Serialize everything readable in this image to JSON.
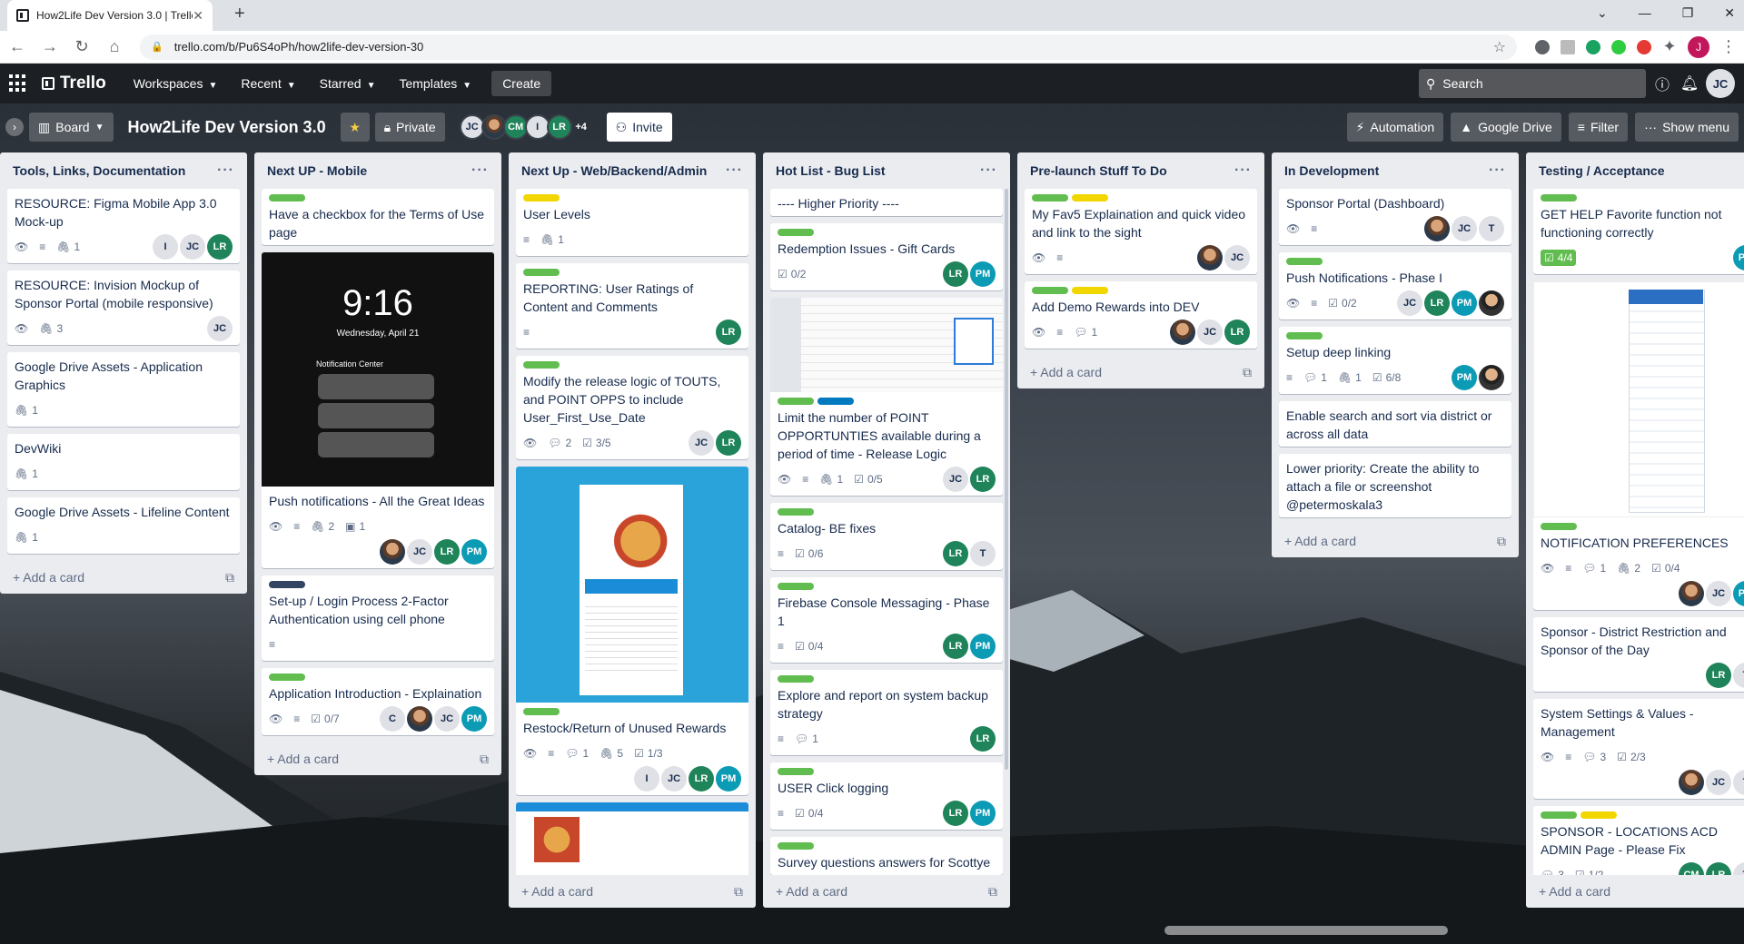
{
  "browser": {
    "tab_title": "How2Life Dev Version 3.0 | Trello",
    "url": "trello.com/b/Pu6S4oPh/how2life-dev-version-30",
    "profile": "J"
  },
  "header": {
    "logo": "Trello",
    "nav": [
      "Workspaces",
      "Recent",
      "Starred",
      "Templates"
    ],
    "create": "Create",
    "search_placeholder": "Search",
    "avatar": "JC"
  },
  "board": {
    "view": "Board",
    "title": "How2Life Dev Version 3.0",
    "visibility": "Private",
    "members": [
      "JC",
      "",
      "CM",
      "I",
      "LR"
    ],
    "more_members": "+4",
    "invite": "Invite",
    "automation": "Automation",
    "google_drive": "Google Drive",
    "filter": "Filter",
    "show_menu": "Show menu"
  },
  "colors": {
    "green": "#61bd4f",
    "yellow": "#f2d600",
    "blue": "#0079bf",
    "navy": "#344563"
  },
  "lists": [
    {
      "title": "Tools, Links, Documentation",
      "add": "Add a card",
      "cards": [
        {
          "title": "RESOURCE: Figma Mobile App 3.0 Mock-up",
          "badges": {
            "attach": "1"
          },
          "members": [
            "I",
            "JC",
            "LR"
          ]
        },
        {
          "title": "RESOURCE: Invision Mockup of Sponsor Portal (mobile responsive)",
          "badges": {
            "attach": "3"
          },
          "members": [
            "JC"
          ]
        },
        {
          "title": "Google Drive Assets - Application Graphics",
          "badges": {
            "attach": "1"
          }
        },
        {
          "title": "DevWiki",
          "badges": {
            "attach": "1"
          }
        },
        {
          "title": "Google Drive Assets - Lifeline Content",
          "badges": {
            "attach": "1"
          }
        }
      ]
    },
    {
      "title": "Next UP - Mobile",
      "add": "Add a card",
      "cards": [
        {
          "title": "Have a checkbox for the Terms of Use page"
        },
        {
          "title": "Push notifications - All the Great Ideas",
          "cover_time": "9:16",
          "cover_date": "Wednesday, April 21",
          "cover_nc": "Notification Center",
          "badges": {
            "attach": "2",
            "cover": "1"
          },
          "members": [
            "photo",
            "JC",
            "LR",
            "PM"
          ]
        },
        {
          "title": "Set-up / Login Process 2-Factor Authentication using cell phone"
        },
        {
          "title": "Application Introduction - Explaination",
          "badges": {
            "check": "0/7"
          },
          "members": [
            "C",
            "photo",
            "JC",
            "PM"
          ]
        }
      ]
    },
    {
      "title": "Next Up - Web/Backend/Admin",
      "add": "Add a card",
      "cards": [
        {
          "title": "User Levels",
          "badges": {
            "attach": "1"
          }
        },
        {
          "title": "REPORTING: User Ratings of Content and Comments",
          "members": [
            "LR"
          ]
        },
        {
          "title": "Modify the release logic of TOUTS, and POINT OPPS to include User_First_Use_Date",
          "badges": {
            "comments": "2",
            "check": "3/5"
          },
          "members": [
            "JC",
            "LR"
          ]
        },
        {
          "title": "Restock/Return of Unused Rewards",
          "badges": {
            "comments": "1",
            "attach": "5",
            "check": "1/3"
          },
          "members": [
            "I",
            "JC",
            "LR",
            "PM"
          ]
        }
      ]
    },
    {
      "title": "Hot List - Bug List",
      "add": "Add a card",
      "cards": [
        {
          "title": "---- Higher Priority ----"
        },
        {
          "title": "Redemption Issues - Gift Cards",
          "badges": {
            "check": "0/2"
          },
          "members": [
            "LR",
            "PM"
          ]
        },
        {
          "title": "Limit the number of POINT OPPORTUNTIES available during a period of time - Release Logic",
          "badges": {
            "attach": "1",
            "check": "0/5"
          },
          "members": [
            "JC",
            "LR"
          ]
        },
        {
          "title": "Catalog- BE fixes",
          "badges": {
            "check": "0/6"
          },
          "members": [
            "LR",
            "T"
          ]
        },
        {
          "title": "Firebase Console Messaging - Phase 1",
          "badges": {
            "check": "0/4"
          },
          "members": [
            "LR",
            "PM"
          ]
        },
        {
          "title": "Explore and report on system backup strategy",
          "badges": {
            "comments": "1"
          },
          "members": [
            "LR"
          ]
        },
        {
          "title": "USER Click logging",
          "badges": {
            "check": "0/4"
          },
          "members": [
            "LR",
            "PM"
          ]
        },
        {
          "title": "Survey questions answers for Scottye"
        }
      ]
    },
    {
      "title": "Pre-launch Stuff To Do",
      "add": "Add a card",
      "cards": [
        {
          "title": "My Fav5 Explaination and quick video and link to the sight",
          "members": [
            "photo",
            "JC"
          ]
        },
        {
          "title": "Add Demo Rewards into DEV",
          "badges": {
            "comments": "1"
          },
          "members": [
            "photo",
            "JC",
            "LR"
          ]
        }
      ]
    },
    {
      "title": "In Development",
      "add": "Add a card",
      "cards": [
        {
          "title": "Sponsor Portal (Dashboard)",
          "members": [
            "photo",
            "JC",
            "T"
          ]
        },
        {
          "title": "Push Notifications - Phase I",
          "badges": {
            "check": "0/2"
          },
          "members": [
            "JC",
            "LR",
            "PM",
            "photo2"
          ]
        },
        {
          "title": "Setup deep linking",
          "badges": {
            "comments": "1",
            "attach": "1",
            "check": "6/8"
          },
          "members": [
            "PM",
            "photo2"
          ]
        },
        {
          "title": "Enable search and sort via district or across all data"
        },
        {
          "title": "Lower priority: Create the ability to attach a file or screenshot @petermoskala3"
        }
      ]
    },
    {
      "title": "Testing / Acceptance",
      "add": "Add a card",
      "cards": [
        {
          "title": "GET HELP Favorite function not functioning correctly",
          "badges": {
            "check": "4/4"
          },
          "members": [
            "PM"
          ]
        },
        {
          "title": "NOTIFICATION PREFERENCES",
          "badges": {
            "comments": "1",
            "attach": "2",
            "check": "0/4"
          },
          "members": [
            "photo",
            "JC",
            "PM"
          ]
        },
        {
          "title": "Sponsor - District Restriction and Sponsor of the Day",
          "members": [
            "LR",
            "T"
          ]
        },
        {
          "title": "System Settings & Values - Management",
          "badges": {
            "comments": "3",
            "check": "2/3"
          },
          "members": [
            "photo",
            "JC",
            "T"
          ]
        },
        {
          "title": "SPONSOR - LOCATIONS ACD ADMIN Page - Please Fix",
          "badges": {
            "comments": "3",
            "check": "1/2"
          },
          "members": [
            "CM",
            "LR",
            "T"
          ]
        }
      ]
    }
  ]
}
